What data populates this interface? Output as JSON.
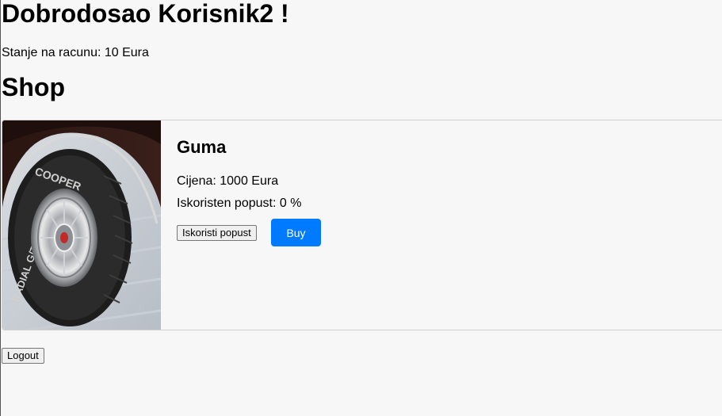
{
  "header": {
    "welcome": "Dobrodosao Korisnik2 !",
    "balance": "Stanje na racunu: 10 Eura",
    "shop_title": "Shop"
  },
  "product": {
    "name": "Guma",
    "price": "Cijena: 1000 Eura",
    "discount": "Iskoristen popust: 0 %",
    "discount_button": "Iskoristi popust",
    "buy_button": "Buy",
    "image_icon": "tire-photo-icon"
  },
  "footer": {
    "logout_button": "Logout"
  },
  "colors": {
    "buy_button": "#007bff",
    "page_background": "#f7f7f7",
    "card_border": "#cfcfcf"
  }
}
